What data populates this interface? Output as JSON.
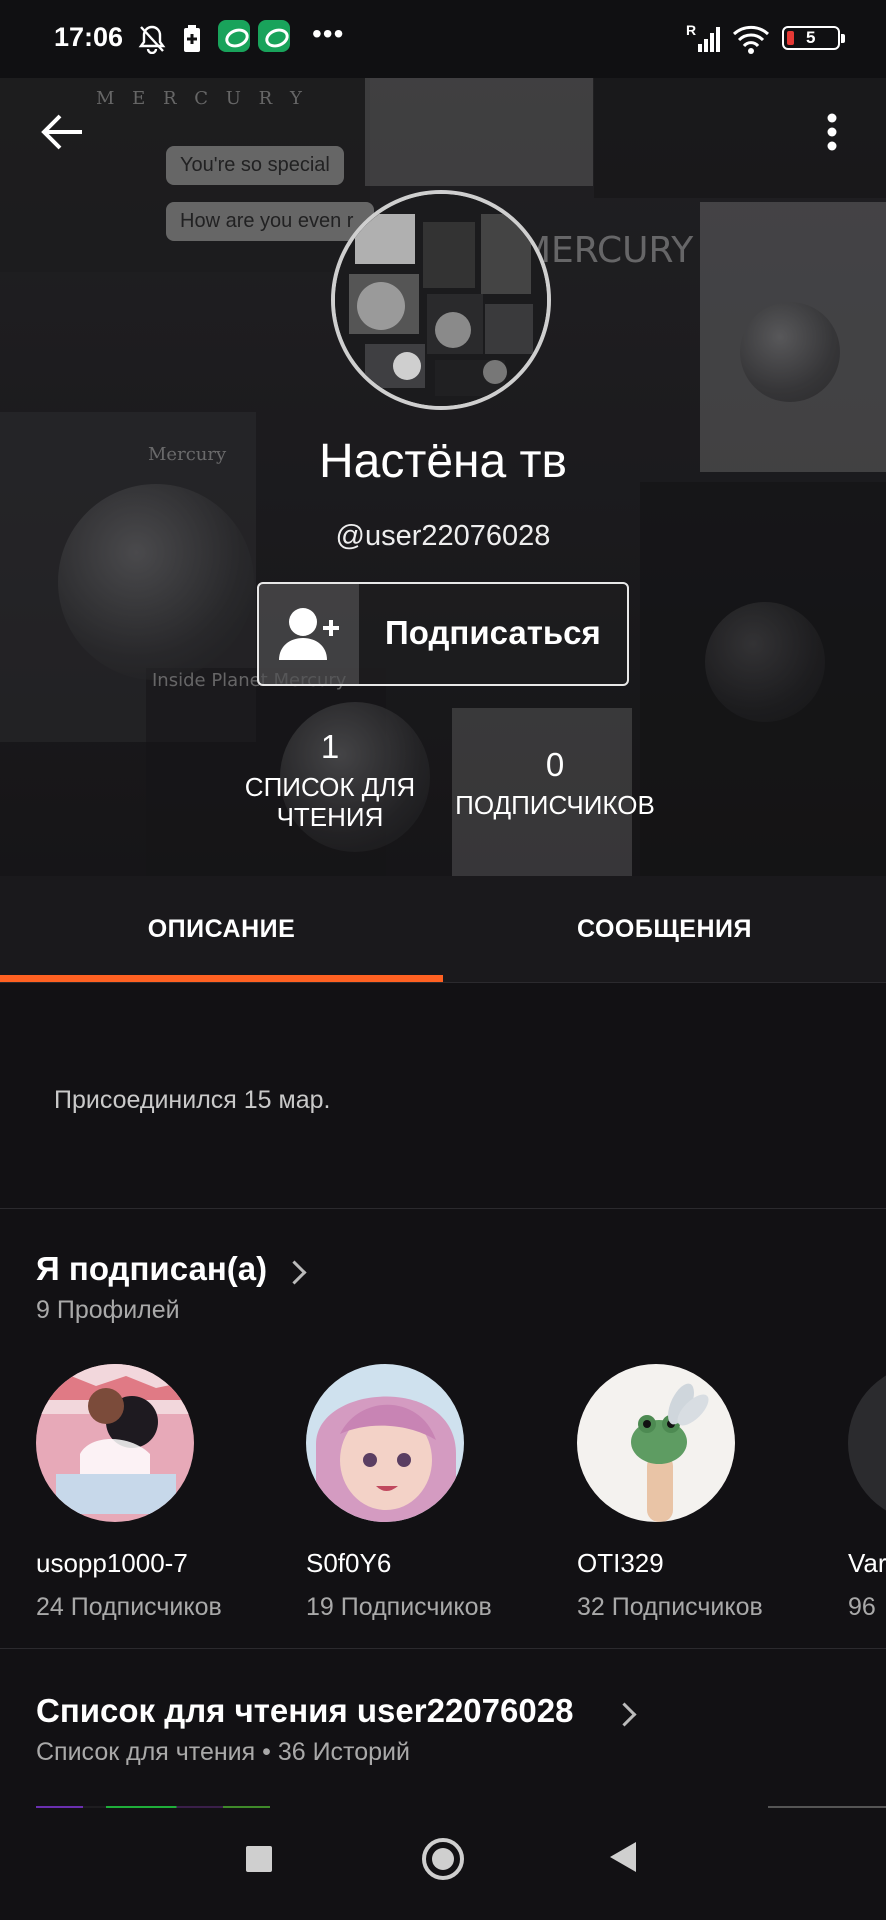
{
  "status_bar": {
    "time": "17:06",
    "more": "•••",
    "battery_level": "5",
    "network": "R"
  },
  "header": {
    "collage_text": {
      "mercury_title": "M E R C U R Y",
      "mercury_big": "MERCURY",
      "mercury_sub": "Mercury",
      "bubble_1": "You're so special",
      "bubble_2": "How are you even r",
      "inside_planet": "Inside Planet Mercury"
    },
    "display_name": "Настёна тв",
    "username": "@user22076028",
    "follow_label": "Подписаться",
    "stats": [
      {
        "value": "1",
        "label": "СПИСОК ДЛЯ\nЧТЕНИЯ"
      },
      {
        "value": "0",
        "label": "ПОДПИСЧИКОВ"
      }
    ]
  },
  "tabs": [
    {
      "label": "ОПИСАНИЕ",
      "active": true
    },
    {
      "label": "СООБЩЕНИЯ",
      "active": false
    }
  ],
  "about": {
    "joined": "Присоединился 15 мар."
  },
  "following": {
    "title": "Я подписан(а)",
    "subtitle": "9 Профилей",
    "profiles": [
      {
        "name": "usopp1000-7",
        "followers": "24 Подписчиков"
      },
      {
        "name": "S0f0Y6",
        "followers": "19 Подписчиков"
      },
      {
        "name": "OTI329",
        "followers": "32 Подписчиков"
      },
      {
        "name": "Var",
        "followers": "96"
      }
    ]
  },
  "reading_list": {
    "title": "Список для чтения user22076028",
    "subtitle": "Список для чтения • 36 Историй"
  },
  "colors": {
    "accent": "#ff6122",
    "background": "#121114",
    "tab_bar": "#1a191c"
  }
}
